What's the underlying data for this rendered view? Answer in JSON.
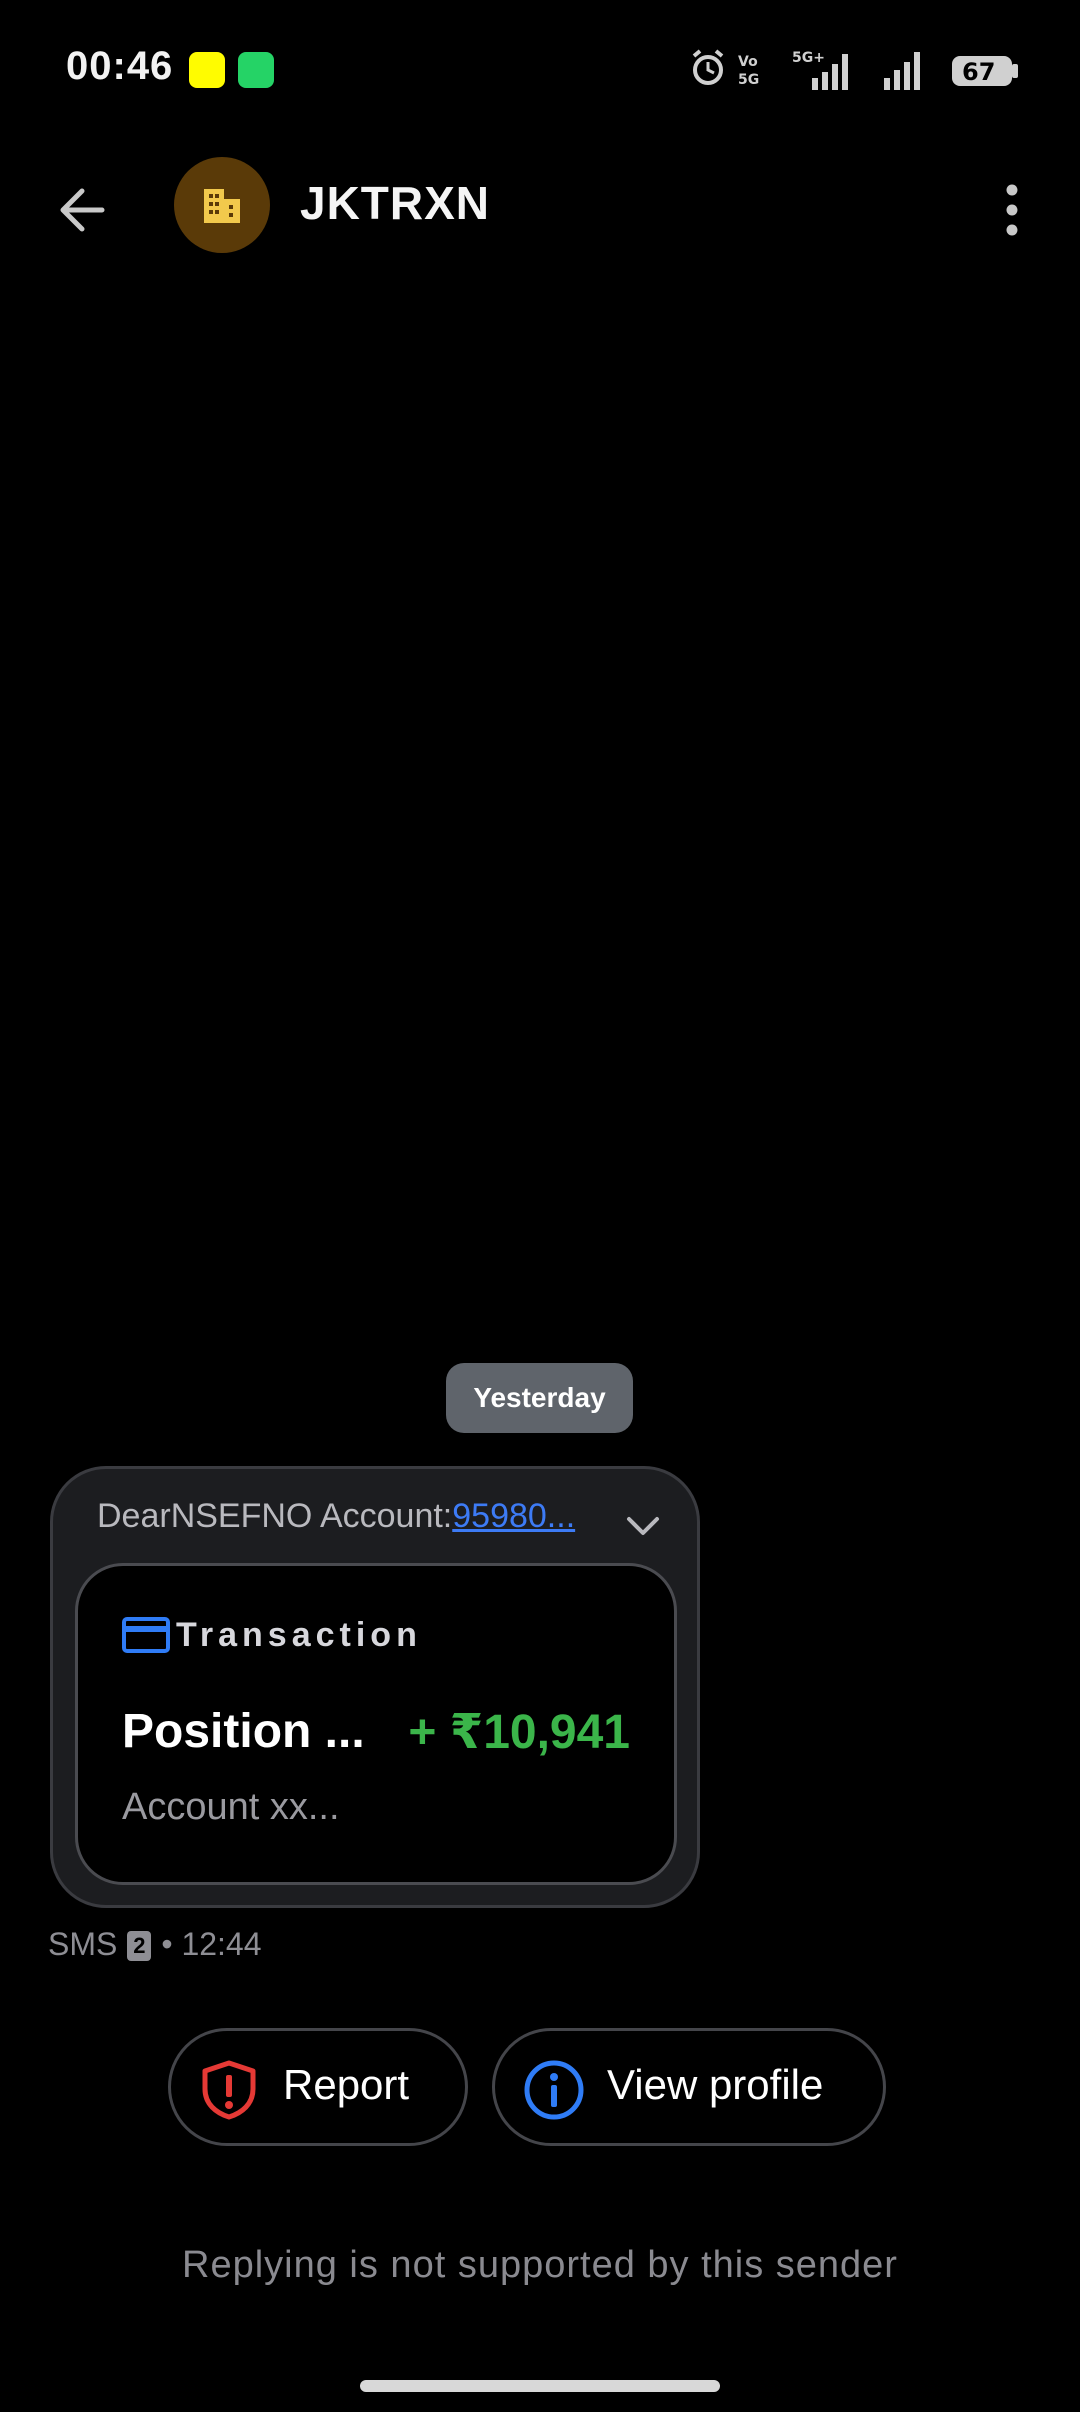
{
  "status_bar": {
    "time": "00:46",
    "battery": "67",
    "network_label": "5G+"
  },
  "header": {
    "sender_name": "JKTRXN"
  },
  "conversation": {
    "date_divider": "Yesterday",
    "message": {
      "preview_prefix": "DearNSEFNO Account:",
      "preview_link": "95980...",
      "card": {
        "type_label": "Transaction",
        "title": "Position ...",
        "amount": "+ ₹10,941",
        "subtitle": "Account xx..."
      },
      "meta": {
        "channel": "SMS",
        "sim": "2",
        "separator": "•",
        "time": "12:44"
      }
    }
  },
  "actions": {
    "report_label": "Report",
    "view_profile_label": "View profile"
  },
  "footer": {
    "reply_notice": "Replying is not supported by this sender"
  },
  "colors": {
    "background": "#000000",
    "amount_positive": "#3bb54a",
    "link": "#3d7bf5",
    "report_icon": "#e53935",
    "info_icon": "#2f7cf6",
    "avatar_bg": "#5a3a08",
    "card_icon": "#2f7cf6"
  }
}
